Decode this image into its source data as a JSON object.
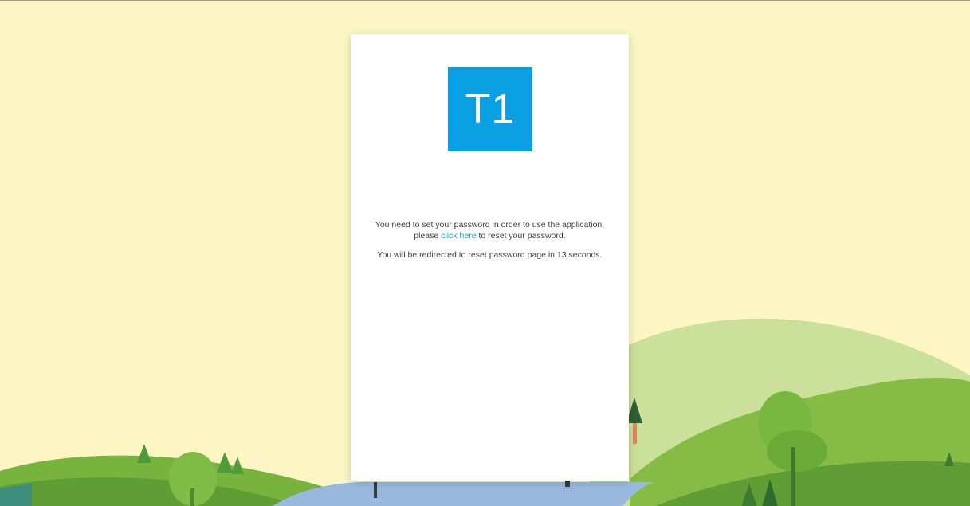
{
  "logo": {
    "text": "T1",
    "color": "#0a9ee3"
  },
  "message": {
    "line1": "You need to set your password in order to use the application,",
    "line2_prefix": "please",
    "link_label": "click here",
    "line2_suffix": "to reset your password.",
    "redirect_prefix": "You will be redirected to reset password page in",
    "redirect_seconds": "13",
    "redirect_suffix": "seconds."
  },
  "colors": {
    "background": "#fbf6c3",
    "link": "#1a9ad8",
    "hill_light": "#c8df96",
    "hill_mid": "#86bc45",
    "hill_dark": "#5f9e35",
    "water": "#9ab8de"
  }
}
